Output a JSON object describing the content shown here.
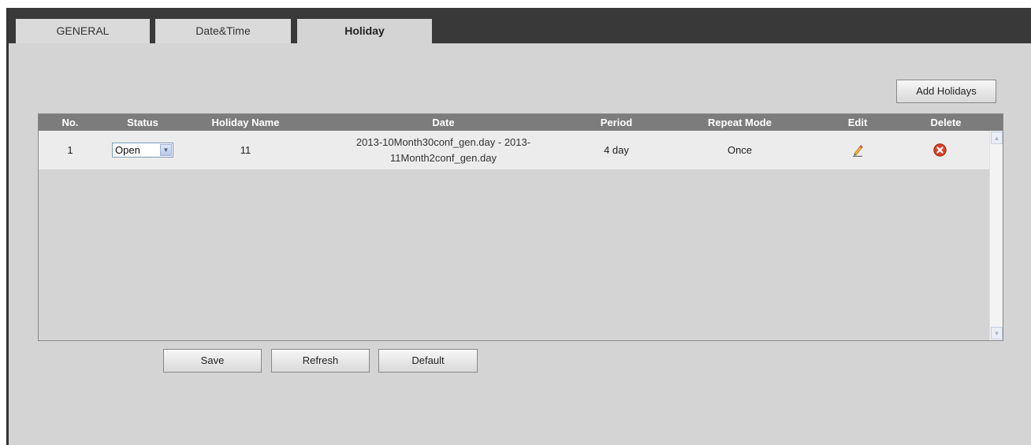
{
  "tabs": [
    {
      "label": "GENERAL",
      "active": false
    },
    {
      "label": "Date&Time",
      "active": false
    },
    {
      "label": "Holiday",
      "active": true
    }
  ],
  "toolbar": {
    "add_label": "Add Holidays"
  },
  "table": {
    "columns": [
      "No.",
      "Status",
      "Holiday Name",
      "Date",
      "Period",
      "Repeat Mode",
      "Edit",
      "Delete"
    ],
    "rows": [
      {
        "no": "1",
        "status": "Open",
        "name": "11",
        "date_line1": "2013-10Month30conf_gen.day - 2013-",
        "date_line2": "11Month2conf_gen.day",
        "period": "4 day",
        "repeat": "Once",
        "edit_icon": "pencil-icon",
        "delete_icon": "red-x-circle-icon"
      }
    ]
  },
  "footer": {
    "save_label": "Save",
    "refresh_label": "Refresh",
    "default_label": "Default"
  },
  "colors": {
    "tabbar": "#393939",
    "panel": "#d4d4d4",
    "header": "#7c7c7c",
    "row": "#ececec",
    "delete_red": "#d93a24"
  }
}
